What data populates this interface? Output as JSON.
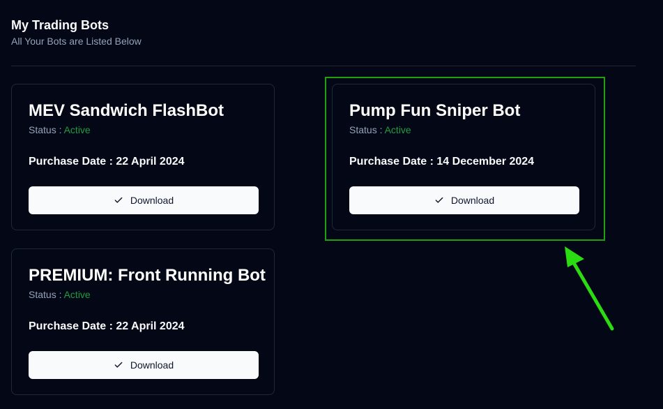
{
  "header": {
    "title": "My Trading Bots",
    "subtitle": "All Your Bots are Listed Below"
  },
  "bots": [
    {
      "name": "MEV Sandwich FlashBot",
      "status_label": "Status :",
      "status_value": "Active",
      "purchase_label": "Purchase Date :",
      "purchase_date": "22 April 2024",
      "download_label": "Download"
    },
    {
      "name": "Pump Fun Sniper Bot",
      "status_label": "Status :",
      "status_value": "Active",
      "purchase_label": "Purchase Date :",
      "purchase_date": "14 December 2024",
      "download_label": "Download"
    },
    {
      "name": "PREMIUM: Front Running Bot",
      "status_label": "Status :",
      "status_value": "Active",
      "purchase_label": "Purchase Date :",
      "purchase_date": "22 April 2024",
      "download_label": "Download"
    }
  ],
  "icons": {
    "download_button": "check-icon",
    "annotation": "arrow-icon"
  },
  "colors": {
    "background": "#040816",
    "status_active": "#1f9d3f",
    "annotation": "#1fa10d"
  }
}
